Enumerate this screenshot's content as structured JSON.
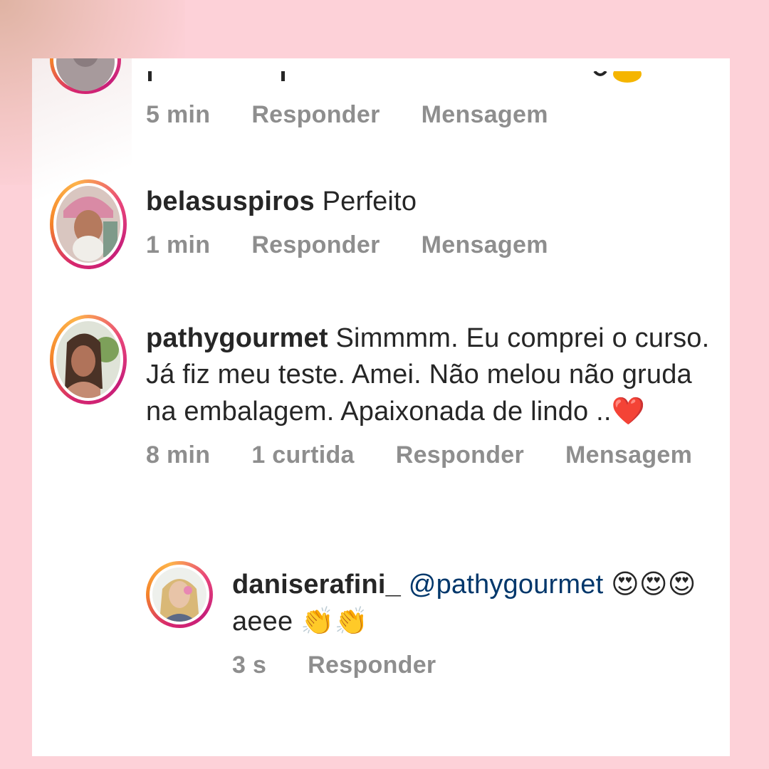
{
  "comments": [
    {
      "meta": {
        "time": "5 min",
        "reply_label": "Responder",
        "message_label": "Mensagem"
      }
    },
    {
      "username": "belasuspiros",
      "text": "Perfeito",
      "meta": {
        "time": "1 min",
        "reply_label": "Responder",
        "message_label": "Mensagem"
      }
    },
    {
      "username": "pathygourmet",
      "text": "Simmmm. Eu comprei o curso. Já fiz meu teste.  Amei. Não melou não gruda na embalagem. Apaixonada de lindo ..",
      "emoji": "❤️",
      "meta": {
        "time": "8 min",
        "likes": "1 curtida",
        "reply_label": "Responder",
        "message_label": "Mensagem"
      }
    }
  ],
  "reply": {
    "username": "daniserafini_",
    "mention": "@pathygourmet",
    "emoji_before": "😍😍😍",
    "text": "aeee",
    "emoji_after": "👏👏",
    "meta": {
      "time": "3 s",
      "reply_label": "Responder"
    }
  },
  "colors": {
    "background": "#fdd1d8",
    "card": "#ffffff",
    "text": "#262626",
    "meta_text": "#8e8e8e",
    "mention": "#00376b"
  }
}
